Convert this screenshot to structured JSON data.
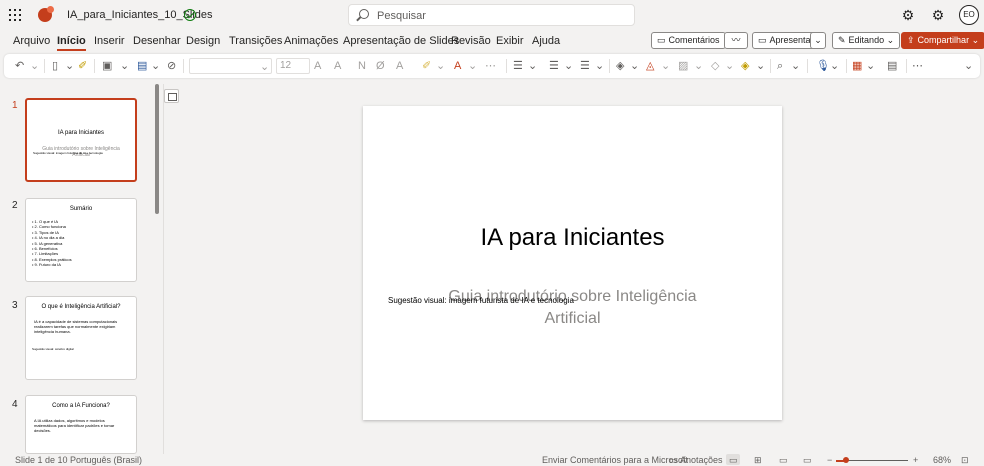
{
  "titlebar": {
    "doc_title": "IA_para_Iniciantes_10_Slides",
    "search_placeholder": "Pesquisar",
    "avatar_initials": "EO"
  },
  "menu": {
    "tabs": [
      "Arquivo",
      "Início",
      "Inserir",
      "Desenhar",
      "Design",
      "Transições",
      "Animações",
      "Apresentação de Slides",
      "Revisão",
      "Exibir",
      "Ajuda"
    ],
    "active_tab": "Início",
    "comments_label": "Comentários",
    "present_label": "Apresentar",
    "editing_label": "Editando",
    "share_label": "Compartilhar"
  },
  "ribbon": {
    "font_size": "12"
  },
  "thumbnails": [
    {
      "num": "1",
      "title": "IA para Iniciantes",
      "subtitle": "Guia introdutório sobre Inteligência Artificial",
      "note": "Sugestão visual: imagem futurista de IA e tecnologia"
    },
    {
      "num": "2",
      "title": "Sumário",
      "items": [
        "1. O que é IA",
        "2. Como funciona",
        "3. Tipos de IA",
        "4. IA no dia a dia",
        "5. IA generativa",
        "6. Benefícios",
        "7. Limitações",
        "8. Exemplos práticos",
        "9. Futuro da IA"
      ]
    },
    {
      "num": "3",
      "title": "O que é Inteligência Artificial?",
      "body": "IA é a capacidade de sistemas computacionais realizarem tarefas que normalmente exigiriam inteligência humana.",
      "note": "Sugestão visual: cérebro digital"
    },
    {
      "num": "4",
      "title": "Como a IA Funciona?",
      "body": "A IA utiliza dados, algoritmos e modelos matemáticos para identificar padrões e tomar decisões."
    }
  ],
  "slide": {
    "title": "IA para Iniciantes",
    "subtitle": "Guia introdutório sobre Inteligência Artificial",
    "note": "Sugestão visual: imagem futurista de IA e tecnologia"
  },
  "status": {
    "slide_of": "Slide 1 de 10",
    "language": "Português (Brasil)",
    "feedback": "Enviar Comentários para a Microsoft",
    "notes": "Anotações",
    "zoom_level": "68%",
    "zoom_fraction": 0.14
  },
  "colors": {
    "accent": "#c43e1c"
  }
}
